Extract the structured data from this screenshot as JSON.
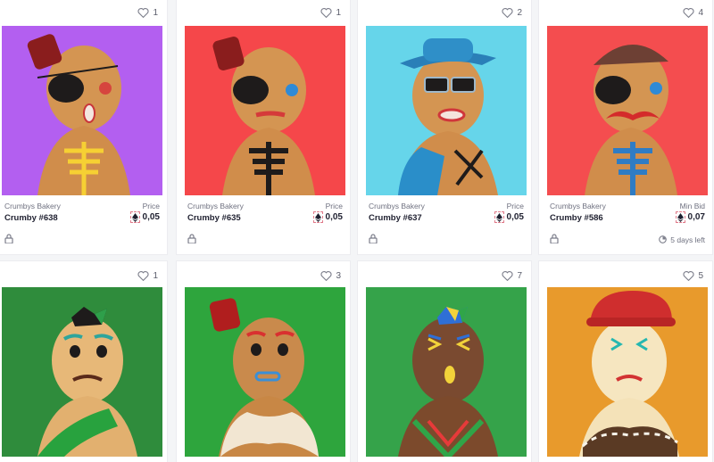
{
  "cards": [
    {
      "likes": "1",
      "bg": "#b35ff0",
      "collection": "Crumbys Bakery",
      "name": "Crumby #638",
      "price_label": "Price",
      "price": "0,05"
    },
    {
      "likes": "1",
      "bg": "#f5474a",
      "collection": "Crumbys Bakery",
      "name": "Crumby #635",
      "price_label": "Price",
      "price": "0,05"
    },
    {
      "likes": "2",
      "bg": "#66d5ea",
      "collection": "Crumbys Bakery",
      "name": "Crumby #637",
      "price_label": "Price",
      "price": "0,05"
    },
    {
      "likes": "4",
      "bg": "#f44d4f",
      "collection": "Crumbys Bakery",
      "name": "Crumby #586",
      "price_label": "Min Bid",
      "price": "0,07",
      "time_left": "5 days left"
    },
    {
      "likes": "1",
      "bg": "#2f8c3c"
    },
    {
      "likes": "3",
      "bg": "#2ea53d"
    },
    {
      "likes": "7",
      "bg": "#35a34a"
    },
    {
      "likes": "5",
      "bg": "#e89a2c"
    }
  ]
}
